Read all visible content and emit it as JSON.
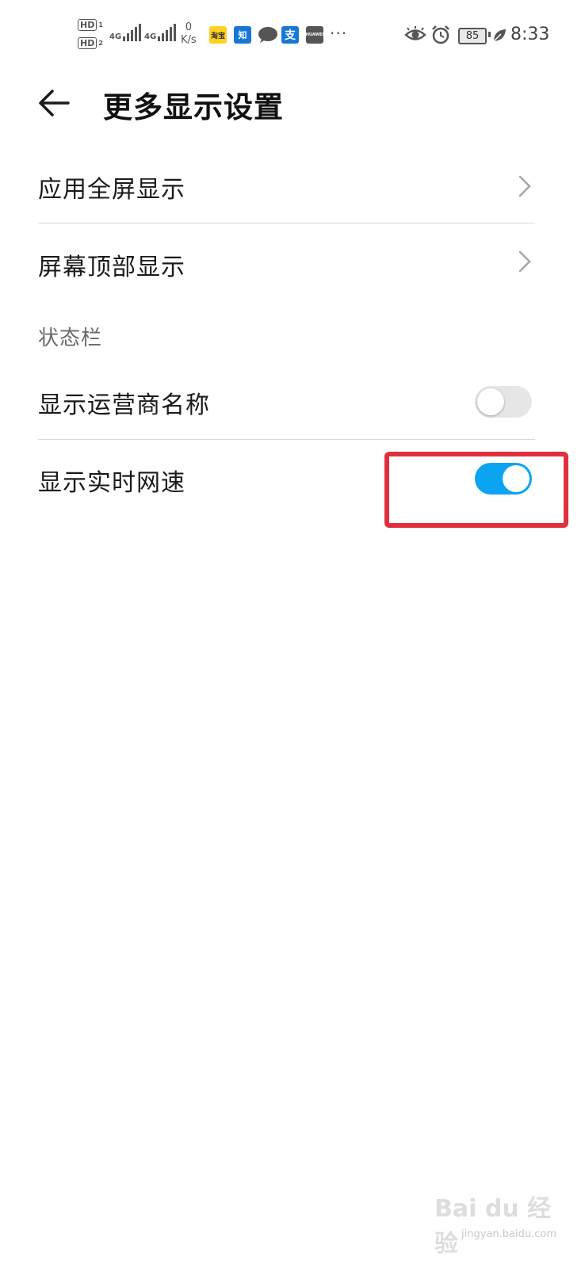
{
  "status_bar": {
    "hd1": "HD",
    "hd1_sub": "1",
    "hd2": "HD",
    "hd2_sub": "2",
    "net1": "4G",
    "net2": "4G",
    "speed_value": "0",
    "speed_unit": "K/s",
    "app_icons": [
      "淘宝",
      "知",
      "message-icon",
      "支",
      "HUAWEI"
    ],
    "more": "···",
    "battery": "85",
    "time": "8:33"
  },
  "header": {
    "title": "更多显示设置",
    "back_icon": "arrow-left-icon"
  },
  "settings": {
    "items": [
      {
        "label": "应用全屏显示",
        "type": "link"
      },
      {
        "label": "屏幕顶部显示",
        "type": "link"
      }
    ],
    "status_section_title": "状态栏",
    "toggles": [
      {
        "label": "显示运营商名称",
        "on": false
      },
      {
        "label": "显示实时网速",
        "on": true
      }
    ]
  },
  "watermark": {
    "logo_text": "Bai du 经验",
    "url": "jingyan.baidu.com"
  },
  "colors": {
    "toggle_on": "#0aa4f0",
    "toggle_off": "#e6e6e6",
    "highlight": "#e0303e"
  }
}
